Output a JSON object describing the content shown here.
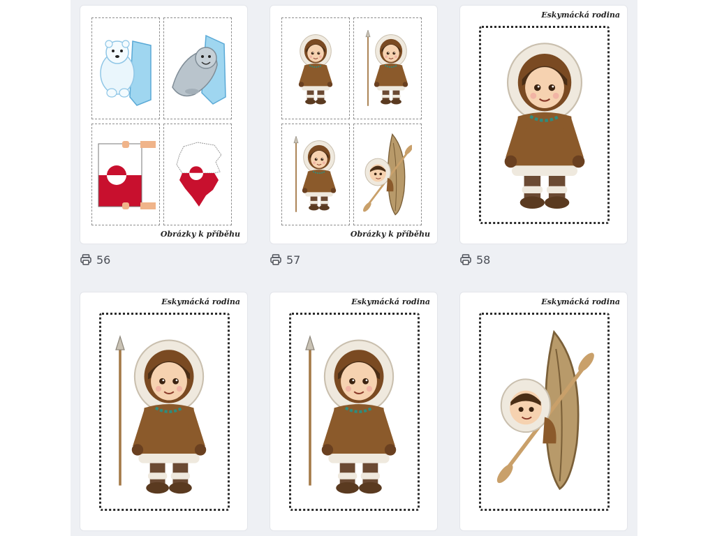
{
  "cards": [
    {
      "caption": "Obrázky k příběhu",
      "count": "56"
    },
    {
      "caption": "Obrázky k příběhu",
      "count": "57"
    },
    {
      "caption": "Eskymácká rodina",
      "count": "58"
    },
    {
      "caption": "Eskymácká rodina"
    },
    {
      "caption": "Eskymácká rodina"
    },
    {
      "caption": "Eskymácká rodina"
    }
  ],
  "icons": {
    "print": "printer-icon"
  },
  "colors": {
    "panel_bg": "#eef0f4",
    "coat_brown": "#8b5a2b",
    "fur_white": "#f4f1ea",
    "greenland_red": "#c8102e"
  }
}
